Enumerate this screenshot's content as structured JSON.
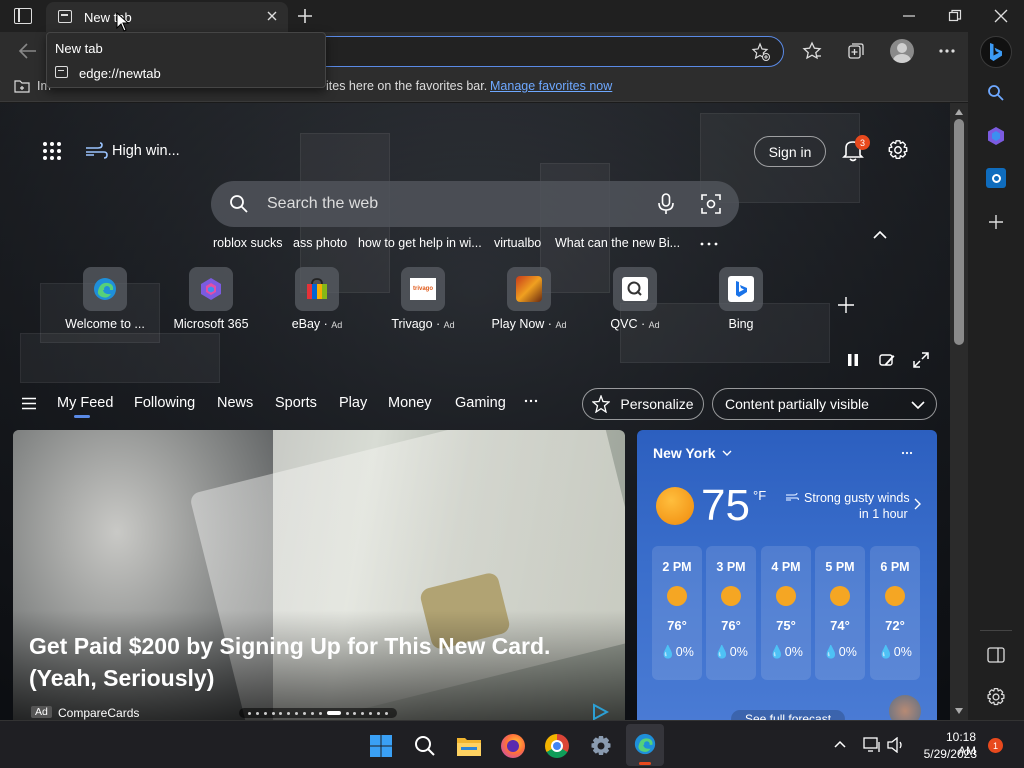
{
  "tab": {
    "title": "New tab"
  },
  "tooltip": {
    "title": "New tab",
    "url": "edge://newtab"
  },
  "favbar": {
    "prefix": "Im",
    "text": "ites here on the favorites bar.",
    "manage_link": "Manage favorites now"
  },
  "weather_nav": {
    "label": "High win..."
  },
  "sign_in": "Sign in",
  "notifications": {
    "count": "3"
  },
  "search": {
    "placeholder": "Search the web"
  },
  "trending": [
    "roblox sucks",
    "ass photo",
    "how to get help in wi...",
    "virtualbo",
    "What can the new Bi..."
  ],
  "quick_links": [
    {
      "label": "Welcome to ...",
      "ad": ""
    },
    {
      "label": "Microsoft 365",
      "ad": ""
    },
    {
      "label": "eBay",
      "ad": "Ad"
    },
    {
      "label": "Trivago",
      "ad": "Ad"
    },
    {
      "label": "Play Now",
      "ad": "Ad"
    },
    {
      "label": "QVC",
      "ad": "Ad"
    },
    {
      "label": "Bing",
      "ad": ""
    }
  ],
  "feed_tabs": [
    "My Feed",
    "Following",
    "News",
    "Sports",
    "Play",
    "Money",
    "Gaming"
  ],
  "personalize": "Personalize",
  "content_visibility": "Content partially visible",
  "hero": {
    "headline": "Get Paid $200 by Signing Up for This New Card. (Yeah, Seriously)",
    "ad_badge": "Ad",
    "source": "CompareCards"
  },
  "weather": {
    "city": "New York",
    "temp": "75",
    "unit": "°F",
    "alert_line1": "Strong gusty winds",
    "alert_line2": "in 1 hour",
    "hours": [
      {
        "time": "2 PM",
        "temp": "76°",
        "precip": "0%"
      },
      {
        "time": "3 PM",
        "temp": "76°",
        "precip": "0%"
      },
      {
        "time": "4 PM",
        "temp": "75°",
        "precip": "0%"
      },
      {
        "time": "5 PM",
        "temp": "74°",
        "precip": "0%"
      },
      {
        "time": "6 PM",
        "temp": "72°",
        "precip": "0%"
      }
    ],
    "forecast_link": "See full forecast"
  },
  "clock": {
    "time": "10:18 AM",
    "date": "5/29/2023"
  },
  "tray_notifications": "1",
  "colors": {
    "accent": "#5a8ae6",
    "link": "#6ea8ff",
    "weather_blue": "#3b6fcc",
    "sun": "#f5a623",
    "badge": "#e8491d"
  }
}
